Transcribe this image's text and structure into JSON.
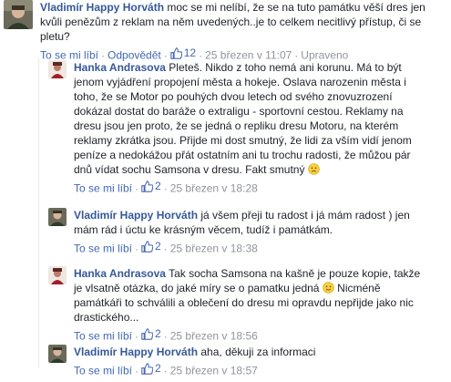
{
  "comments": [
    {
      "author": "Vladimír Happy Horváth",
      "text": "moc se mi nelíbí, že se na tuto památku věší dres jen kvůli penězům z reklam na něm uvedených..je to celkem necitlivý přístup, či se pletu?",
      "like": "To se mi líbí",
      "reply": "Odpovědět",
      "likes": "12",
      "time": "25 březen v 11:07",
      "edited": "Upraveno"
    },
    {
      "author": "Hanka Andrasova",
      "text": "Pleteš. Nikdo z toho nemá ani korunu. Má to být jenom vyjádření propojení města a hokeje. Oslava narozenin města i toho, že se Motor po pouhých dvou letech od svého znovuzrození dokázal dostat do baráže o extraligu - sportovní cestou. Reklamy na dresu jsou jen proto, že se jedná o repliku dresu Motoru, na kterém reklamy zkrátka jsou. Přijde mi dost smutný, že lidi za vším vidí jenom peníze a nedokážou přát ostatním ani tu trochu radosti, že můžou pár dnů vídat sochu Samsona v dresu. Fakt smutný",
      "like": "To se mi líbí",
      "likes": "2",
      "time": "25 březen v 18:28"
    },
    {
      "author": "Vladimír Happy Horváth",
      "text": "já všem přeji tu radost i já mám radost ) jen mám rád i úctu ke krásným věcem, tudíž i památkám.",
      "like": "To se mi líbí",
      "likes": "2",
      "time": "25 březen v 18:38"
    },
    {
      "author": "Hanka Andrasova",
      "text_a": "Tak socha Samsona na kašně je pouze kopie, takže je vlsatně otázka, do jaké míry se o pamatku jedná",
      "text_b": "Nicméně památkáři to schválili a oblečení do dresu mi opravdu nepřijde jako nic drastického...",
      "like": "To se mi líbí",
      "likes": "2",
      "time": "25 březen v 18:56"
    },
    {
      "author": "Vladimír Happy Horváth",
      "text": "aha, děkuji za informaci",
      "like": "To se mi líbí",
      "likes": "2",
      "time": "25 březen v 18:57"
    }
  ],
  "icons": {
    "like": "thumbs-up-icon",
    "emoji_sad": "frown-emoji-icon",
    "emoji_smile": "smile-emoji-icon"
  },
  "colors": {
    "link": "#4267b2",
    "author": "#365899",
    "meta": "#90949c"
  }
}
